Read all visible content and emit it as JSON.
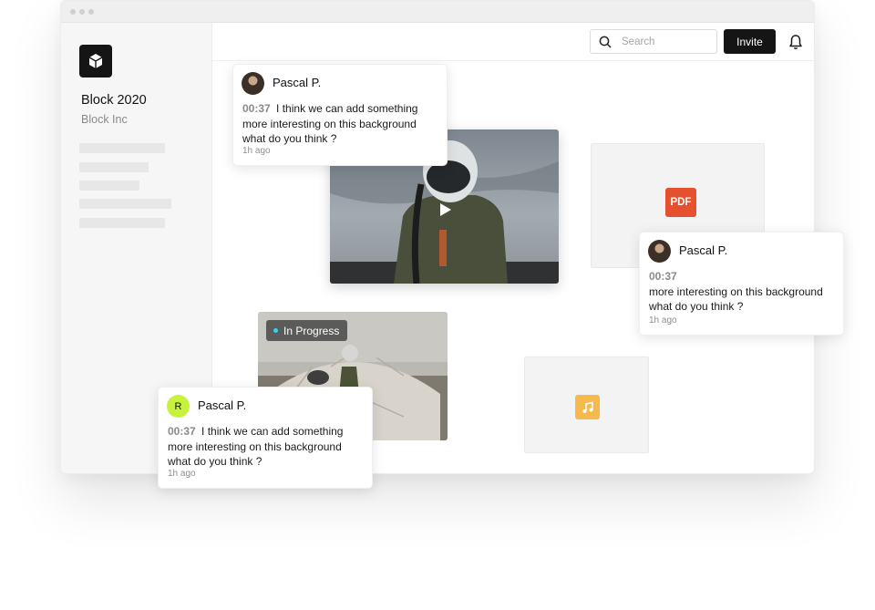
{
  "workspace": {
    "name": "Block 2020",
    "org": "Block Inc"
  },
  "header": {
    "search_placeholder": "Search",
    "invite_label": "Invite"
  },
  "media": {
    "pdf_label": "PDF",
    "status_label": "In Progress"
  },
  "comments": [
    {
      "author": "Pascal P.",
      "time": "00:37",
      "text": "I think we can add something more interesting on this background what do you think ?",
      "ago": "1h ago"
    },
    {
      "author": "Pascal P.",
      "time": "00:37",
      "text": "more interesting on this background what do you think ?",
      "ago": "1h ago"
    },
    {
      "author": "Pascal P.",
      "avatar_initial": "R",
      "time": "00:37",
      "text": "I think we can add something more interesting on this background what do you think ?",
      "ago": "1h ago"
    }
  ],
  "colors": {
    "accent_dark": "#151515",
    "pdf": "#e5512e",
    "music": "#f5b94c",
    "status_dot": "#38d1f0",
    "avatar_green": "#c7f23c"
  },
  "icons": [
    "cube-icon",
    "search-icon",
    "bell-icon",
    "play-icon",
    "music-note-icon"
  ]
}
